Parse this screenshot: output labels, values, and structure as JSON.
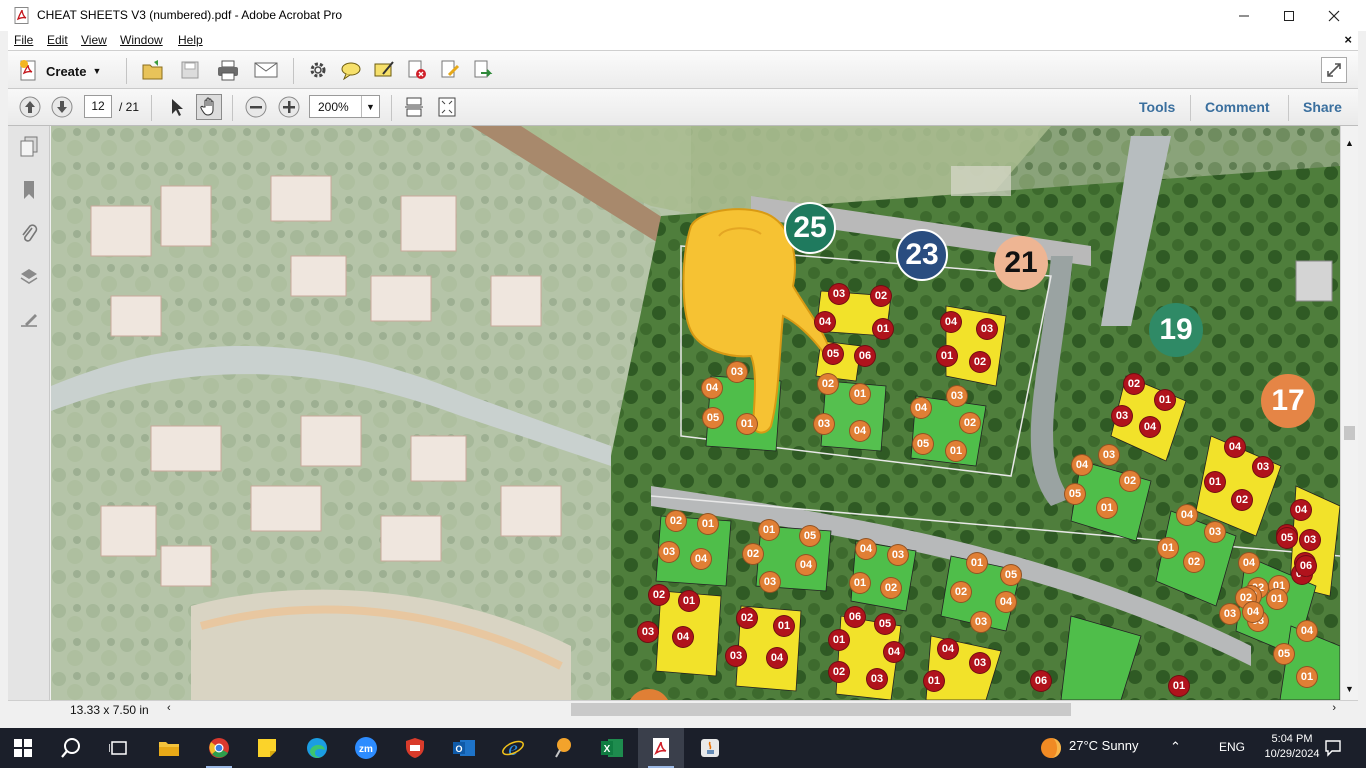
{
  "window": {
    "title": "CHEAT SHEETS V3 (numbered).pdf - Adobe Acrobat Pro"
  },
  "menu": {
    "items": [
      "File",
      "Edit",
      "View",
      "Window",
      "Help"
    ]
  },
  "toolbar": {
    "create_label": "Create",
    "icons": [
      "open-icon",
      "save-icon",
      "print-icon",
      "email-icon",
      "settings-icon",
      "comment-icon",
      "sign-icon",
      "security-icon",
      "edit-icon",
      "export-icon"
    ]
  },
  "navigation": {
    "page_current": "12",
    "page_total": "/ 21",
    "zoom": "200%"
  },
  "panels": {
    "tools": "Tools",
    "comment": "Comment",
    "share": "Share"
  },
  "status": {
    "page_size": "13.33 x 7.50 in"
  },
  "map": {
    "plots": [
      {
        "label": "25",
        "color": "#1f7a5e"
      },
      {
        "label": "23",
        "color": "#2a4d80"
      },
      {
        "label": "21",
        "color": "#eeb593"
      },
      {
        "label": "19",
        "color": "#2f8a66"
      },
      {
        "label": "17",
        "color": "#e58546"
      }
    ],
    "units": [
      {
        "label": "03",
        "c": "red"
      },
      {
        "label": "02",
        "c": "red"
      },
      {
        "label": "04",
        "c": "red"
      },
      {
        "label": "01",
        "c": "red"
      },
      {
        "label": "05",
        "c": "red"
      },
      {
        "label": "06",
        "c": "red"
      },
      {
        "label": "04",
        "c": "red"
      },
      {
        "label": "03",
        "c": "red"
      },
      {
        "label": "01",
        "c": "red"
      },
      {
        "label": "02",
        "c": "red"
      },
      {
        "label": "03",
        "c": "orange"
      },
      {
        "label": "04",
        "c": "orange"
      },
      {
        "label": "05",
        "c": "orange"
      },
      {
        "label": "01",
        "c": "orange"
      },
      {
        "label": "02",
        "c": "orange"
      },
      {
        "label": "01",
        "c": "orange"
      },
      {
        "label": "03",
        "c": "orange"
      },
      {
        "label": "04",
        "c": "orange"
      },
      {
        "label": "04",
        "c": "orange"
      },
      {
        "label": "03",
        "c": "orange"
      },
      {
        "label": "02",
        "c": "orange"
      },
      {
        "label": "05",
        "c": "orange"
      },
      {
        "label": "01",
        "c": "orange"
      },
      {
        "label": "02",
        "c": "red"
      },
      {
        "label": "01",
        "c": "red"
      },
      {
        "label": "03",
        "c": "red"
      },
      {
        "label": "04",
        "c": "red"
      },
      {
        "label": "04",
        "c": "red"
      },
      {
        "label": "03",
        "c": "red"
      },
      {
        "label": "01",
        "c": "red"
      },
      {
        "label": "02",
        "c": "red"
      },
      {
        "label": "04",
        "c": "orange"
      },
      {
        "label": "03",
        "c": "orange"
      },
      {
        "label": "02",
        "c": "orange"
      },
      {
        "label": "05",
        "c": "orange"
      },
      {
        "label": "01",
        "c": "orange"
      },
      {
        "label": "02",
        "c": "orange"
      },
      {
        "label": "01",
        "c": "orange"
      },
      {
        "label": "03",
        "c": "orange"
      },
      {
        "label": "04",
        "c": "orange"
      },
      {
        "label": "01",
        "c": "orange"
      },
      {
        "label": "05",
        "c": "orange"
      },
      {
        "label": "02",
        "c": "orange"
      },
      {
        "label": "04",
        "c": "orange"
      },
      {
        "label": "03",
        "c": "orange"
      },
      {
        "label": "04",
        "c": "orange"
      },
      {
        "label": "03",
        "c": "orange"
      },
      {
        "label": "01",
        "c": "orange"
      },
      {
        "label": "02",
        "c": "orange"
      },
      {
        "label": "02",
        "c": "red"
      },
      {
        "label": "01",
        "c": "red"
      },
      {
        "label": "03",
        "c": "red"
      },
      {
        "label": "04",
        "c": "red"
      },
      {
        "label": "02",
        "c": "red"
      },
      {
        "label": "01",
        "c": "red"
      },
      {
        "label": "03",
        "c": "red"
      },
      {
        "label": "04",
        "c": "red"
      },
      {
        "label": "06",
        "c": "red"
      },
      {
        "label": "05",
        "c": "red"
      },
      {
        "label": "01",
        "c": "red"
      },
      {
        "label": "04",
        "c": "red"
      },
      {
        "label": "02",
        "c": "red"
      },
      {
        "label": "03",
        "c": "red"
      },
      {
        "label": "01",
        "c": "orange"
      },
      {
        "label": "05",
        "c": "orange"
      },
      {
        "label": "02",
        "c": "orange"
      },
      {
        "label": "04",
        "c": "orange"
      },
      {
        "label": "03",
        "c": "orange"
      },
      {
        "label": "04",
        "c": "red"
      },
      {
        "label": "03",
        "c": "red"
      },
      {
        "label": "01",
        "c": "red"
      },
      {
        "label": "04",
        "c": "orange"
      },
      {
        "label": "01",
        "c": "orange"
      },
      {
        "label": "03",
        "c": "orange"
      },
      {
        "label": "02",
        "c": "orange"
      },
      {
        "label": "04",
        "c": "orange"
      },
      {
        "label": "02",
        "c": "orange"
      },
      {
        "label": "01",
        "c": "orange"
      },
      {
        "label": "03",
        "c": "orange"
      },
      {
        "label": "02",
        "c": "orange"
      },
      {
        "label": "03",
        "c": "orange"
      },
      {
        "label": "02",
        "c": "orange"
      },
      {
        "label": "01",
        "c": "orange"
      },
      {
        "label": "04",
        "c": "orange"
      },
      {
        "label": "04",
        "c": "red"
      },
      {
        "label": "03",
        "c": "red"
      },
      {
        "label": "01",
        "c": "red"
      },
      {
        "label": "02",
        "c": "red"
      },
      {
        "label": "04",
        "c": "red"
      },
      {
        "label": "05",
        "c": "red"
      },
      {
        "label": "06",
        "c": "red"
      },
      {
        "label": "04",
        "c": "orange"
      },
      {
        "label": "05",
        "c": "orange"
      },
      {
        "label": "01",
        "c": "orange"
      },
      {
        "label": "06",
        "c": "red"
      },
      {
        "label": "01",
        "c": "red"
      }
    ]
  },
  "taskbar": {
    "apps": [
      "start-icon",
      "search-icon",
      "task-view-icon",
      "file-explorer-icon",
      "chrome-icon",
      "sticky-notes-icon",
      "edge-icon",
      "zoom-icon",
      "app-shield-icon",
      "outlook-icon",
      "internet-explorer-icon",
      "maps-pin-icon",
      "excel-icon",
      "acrobat-icon",
      "java-icon"
    ],
    "weather": "27°C  Sunny",
    "lang": "ENG",
    "time": "5:04 PM",
    "date": "10/29/2024"
  }
}
